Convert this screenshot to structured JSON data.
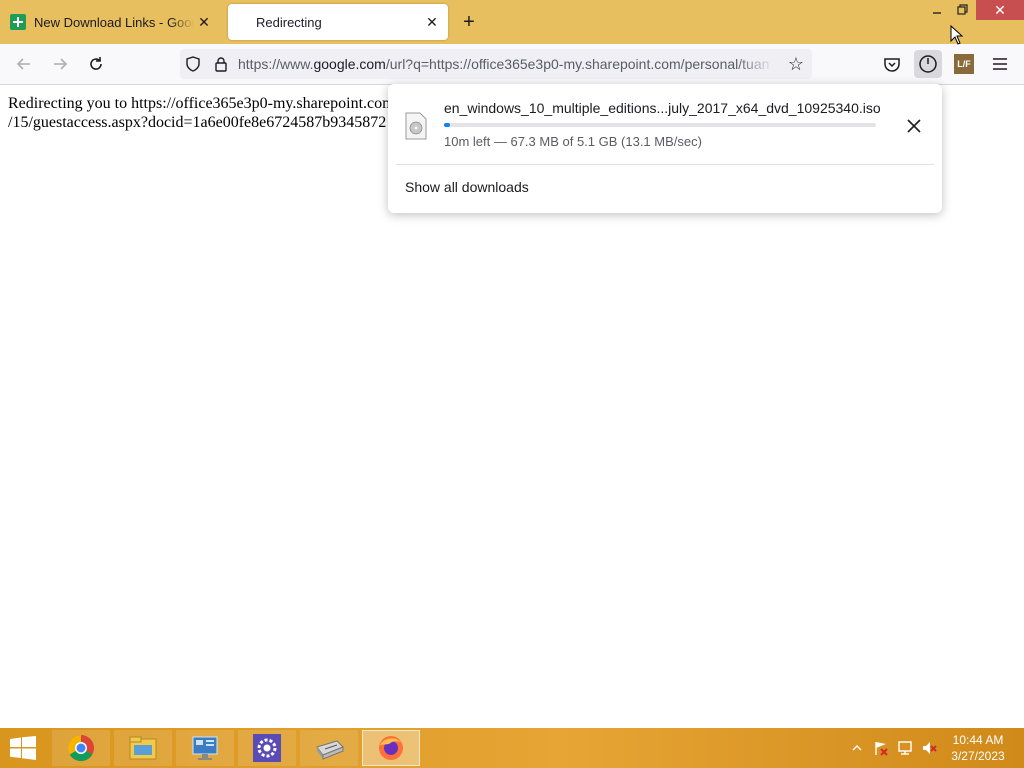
{
  "tabs": [
    {
      "title": "New Download Links - Google Drive",
      "active": false
    },
    {
      "title": "Redirecting",
      "active": true
    }
  ],
  "urlbar": {
    "url_prefix": "https://www.",
    "url_domain": "google.com",
    "url_rest": "/url?q=https://office365e3p0-my.sharepoint.com/personal/tuan"
  },
  "page": {
    "line1": "Redirecting you to https://office365e3p0-my.sharepoint.com",
    "line2": "/15/guestaccess.aspx?docid=1a6e00fe8e6724587b9345872"
  },
  "downloads_panel": {
    "file_name": "en_windows_10_multiple_editions...july_2017_x64_dvd_10925340.iso",
    "status": "10m left — 67.3 MB of 5.1 GB (13.1 MB/sec)",
    "progress_fraction": 0.013,
    "show_all_label": "Show all downloads"
  },
  "extension_badge": "L/F",
  "taskbar": {
    "apps": [
      "chrome-icon",
      "file-explorer-icon",
      "control-panel-icon",
      "settings-icon",
      "scanner-icon",
      "firefox-icon"
    ],
    "time": "10:44 AM",
    "date": "3/27/2023"
  },
  "colors": {
    "tabstrip": "#e8bf5e",
    "accent": "#0a84ff",
    "close_button": "#c74f4f"
  }
}
